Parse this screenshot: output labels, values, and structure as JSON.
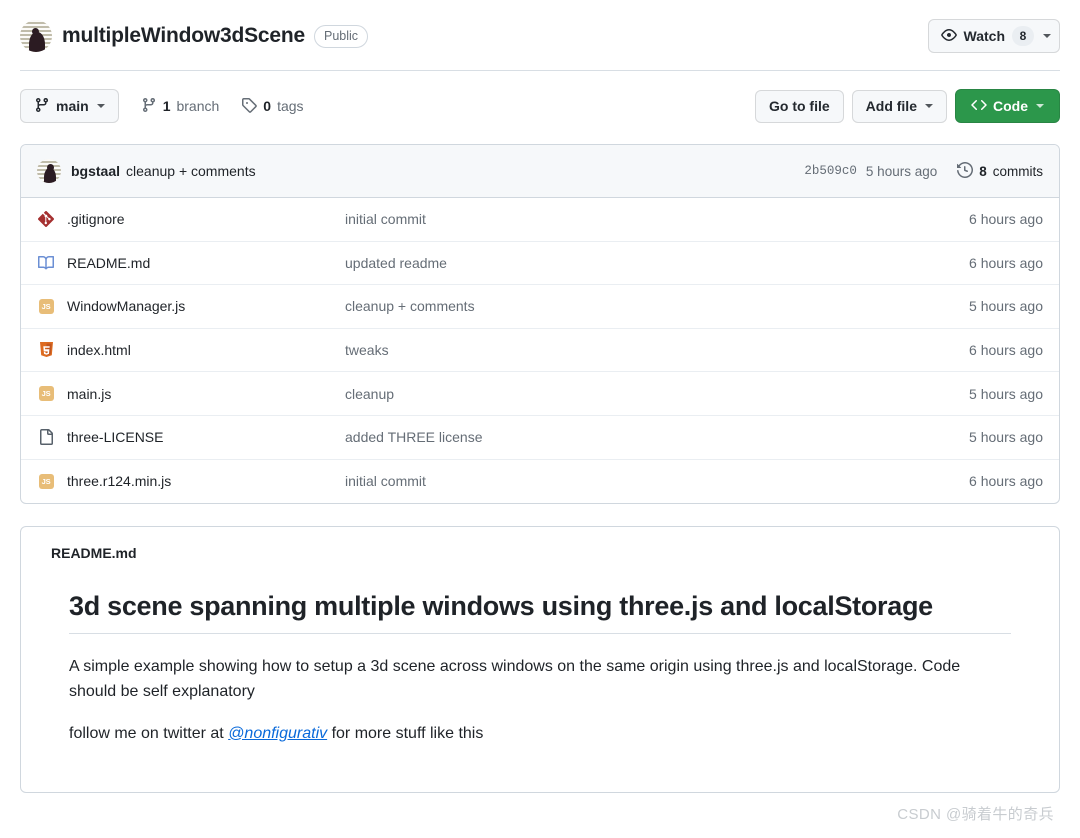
{
  "header": {
    "repo_name": "multipleWindow3dScene",
    "visibility": "Public",
    "avatar_icon": "user-avatar-photo",
    "watch": {
      "icon": "eye-icon",
      "label": "Watch",
      "count": "8",
      "caret_icon": "chevron-down-icon"
    }
  },
  "toolbar": {
    "branch": {
      "icon": "git-branch-icon",
      "name": "main",
      "caret_icon": "chevron-down-icon"
    },
    "branch_count": {
      "icon": "git-branch-icon",
      "number": "1",
      "label": "branch"
    },
    "tag_count": {
      "icon": "tag-icon",
      "number": "0",
      "label": "tags"
    },
    "go_to_file_label": "Go to file",
    "add_file_label": "Add file",
    "code_label": "Code",
    "code_icon": "code-brackets-icon",
    "code_color": "#2c974b"
  },
  "commit_bar": {
    "avatar_icon": "user-avatar-photo",
    "author": "bgstaal",
    "message": "cleanup + comments",
    "sha": "2b509c0",
    "time": "5 hours ago",
    "history_icon": "history-clock-icon",
    "commits_count": "8",
    "commits_label": "commits"
  },
  "files": [
    {
      "icon": "git-diamond-icon",
      "name": ".gitignore",
      "message": "initial commit",
      "time": "6 hours ago"
    },
    {
      "icon": "book-icon",
      "name": "README.md",
      "message": "updated readme",
      "time": "6 hours ago"
    },
    {
      "icon": "javascript-icon",
      "name": "WindowManager.js",
      "message": "cleanup + comments",
      "time": "5 hours ago"
    },
    {
      "icon": "html5-icon",
      "name": "index.html",
      "message": "tweaks",
      "time": "6 hours ago"
    },
    {
      "icon": "javascript-icon",
      "name": "main.js",
      "message": "cleanup",
      "time": "5 hours ago"
    },
    {
      "icon": "file-icon",
      "name": "three-LICENSE",
      "message": "added THREE license",
      "time": "5 hours ago"
    },
    {
      "icon": "javascript-icon",
      "name": "three.r124.min.js",
      "message": "initial commit",
      "time": "6 hours ago"
    }
  ],
  "readme": {
    "label": "README.md",
    "heading": "3d scene spanning multiple windows using three.js and localStorage",
    "paragraph1": "A simple example showing how to setup a 3d scene across windows on the same origin using three.js and localStorage. Code should be self explanatory",
    "paragraph2_before": "follow me on twitter at ",
    "paragraph2_link": "@nonfigurativ",
    "paragraph2_after": " for more stuff like this"
  },
  "watermark": "CSDN @骑着牛的奇兵"
}
